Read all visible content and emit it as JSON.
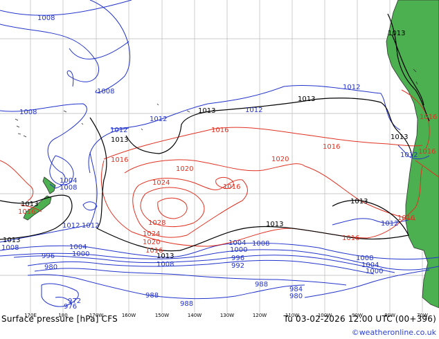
{
  "map": {
    "title": "Surface pressure [hPa] CFS",
    "valid_time": "Tu 03-02-2026 12:00 UTC (00+396)",
    "credit": "©weatheronline.co.uk",
    "longitude_labels": [
      "170E",
      "180",
      "170W",
      "160W",
      "150W",
      "140W",
      "130W",
      "120W",
      "110W",
      "100W",
      "90W",
      "80W",
      "70W"
    ],
    "isobar_labels": {
      "black": [
        "1013"
      ],
      "blue": [
        "1012",
        "1008",
        "1004",
        "1000",
        "996",
        "992",
        "988",
        "984",
        "980",
        "976",
        "972"
      ],
      "red": [
        "1016",
        "1020",
        "1024",
        "1028"
      ]
    },
    "colors": {
      "ocean": "#ffffff",
      "land": "#4caf50",
      "grid": "#b8b8b8",
      "coast": "#303030",
      "isobar_low": "#2233cc",
      "isobar_high": "#e03020",
      "isobar_1013": "#000000"
    }
  }
}
